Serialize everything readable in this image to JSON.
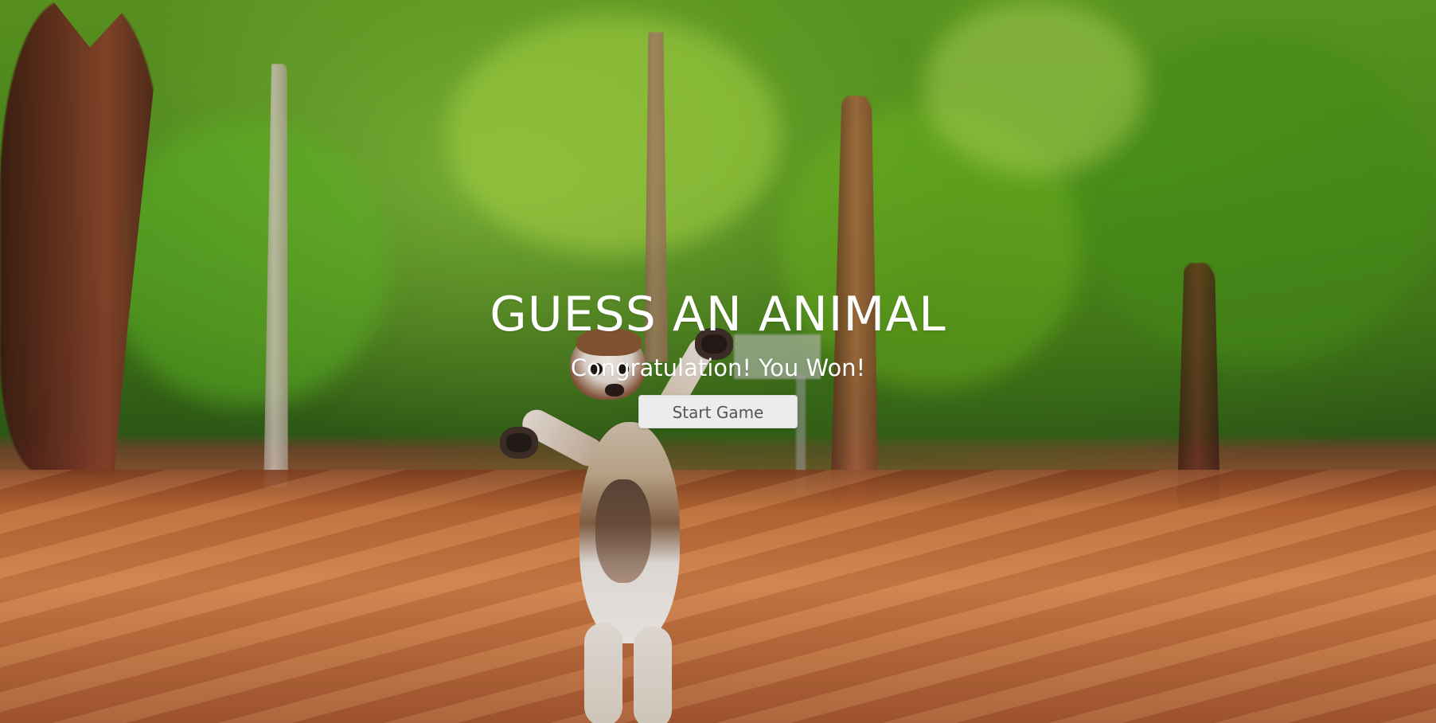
{
  "game": {
    "title": "GUESS AN ANIMAL",
    "status_message": "Congratulation! You Won!",
    "start_button_label": "Start Game"
  },
  "scene": {
    "background_subject": "lemur in forest",
    "accent_colors": {
      "forest_green": "#5f9d22",
      "ground_orange": "#c9773f",
      "button_bg": "#ececec",
      "button_text": "#555555"
    }
  }
}
